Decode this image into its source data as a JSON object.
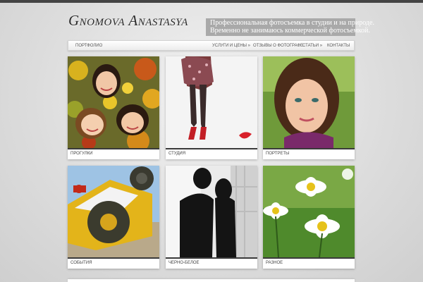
{
  "header": {
    "site_title": "Gnomova Anastasya",
    "tagline_line1": "Профессиональная фотосъемка в студии и на природе.",
    "tagline_line2": "Временно не занимаюсь коммерческой фотосъемкой."
  },
  "nav": {
    "portfolio": "портфолио",
    "services": "услуги и цены »",
    "reviews": "отзывы о фотографе",
    "articles": "статьи »",
    "contacts": "контакты"
  },
  "gallery": [
    {
      "label": "прогулки",
      "icon": "girls-in-leaves-photo"
    },
    {
      "label": "студия",
      "icon": "studio-legs-photo"
    },
    {
      "label": "портреты",
      "icon": "portrait-photo"
    },
    {
      "label": "события",
      "icon": "offroad-truck-photo"
    },
    {
      "label": "черно-белое",
      "icon": "kissing-couple-photo"
    },
    {
      "label": "разное",
      "icon": "daisies-photo"
    }
  ],
  "colors": {
    "background": "#dcdcdc",
    "tagline_bg": "#a9a9a9",
    "card_separator": "#3a3a3a"
  }
}
